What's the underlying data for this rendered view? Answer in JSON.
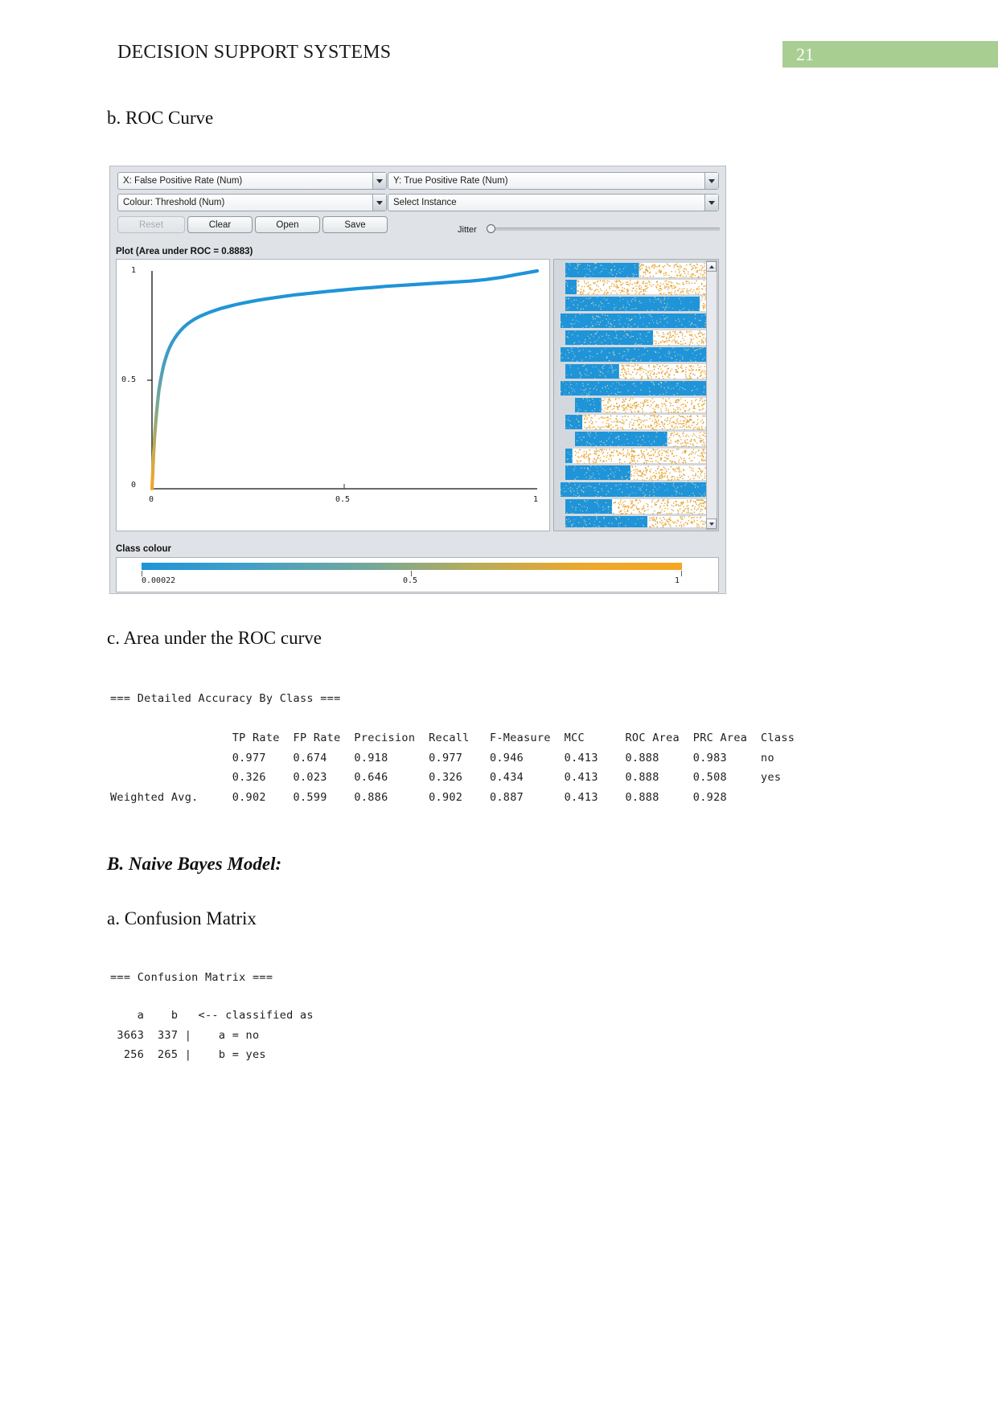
{
  "header": {
    "title": "DECISION SUPPORT SYSTEMS",
    "page_number": "21",
    "badge_color": "#a9ce92"
  },
  "sections": {
    "roc_curve_heading": "b. ROC Curve",
    "auc_heading": "c. Area under the ROC curve",
    "model_heading": "B. Naive Bayes Model:",
    "confusion_heading": "a. Confusion Matrix"
  },
  "weka": {
    "x_axis_combo": "X: False Positive Rate (Num)",
    "y_axis_combo": "Y: True Positive Rate (Num)",
    "colour_combo": "Colour: Threshold (Num)",
    "select_instance": "Select Instance",
    "buttons": {
      "reset": "Reset",
      "clear": "Clear",
      "open": "Open",
      "save": "Save"
    },
    "reset_enabled": false,
    "jitter_label": "Jitter",
    "plot_label": "Plot (Area under ROC = 0.8883)",
    "x_marker": "X",
    "y_marker": "Y",
    "class_colour_label": "Class colour",
    "class_colour_ticks": [
      "0.00022",
      "0.5",
      "1"
    ],
    "colour_start": "#1f94d8",
    "colour_end": "#f5a623"
  },
  "chart_data": {
    "type": "line",
    "title": "Plot (Area under ROC = 0.8883)",
    "xlabel": "False Positive Rate",
    "ylabel": "True Positive Rate",
    "xlim": [
      0,
      1
    ],
    "ylim": [
      0,
      1
    ],
    "xticks": [
      "0",
      "0.5",
      "1"
    ],
    "yticks": [
      "0",
      "0.5",
      "1"
    ],
    "grid": false,
    "legend": null,
    "auc": 0.8883,
    "series": [
      {
        "name": "ROC",
        "x": [
          0.0,
          0.002,
          0.004,
          0.006,
          0.009,
          0.012,
          0.015,
          0.018,
          0.022,
          0.026,
          0.03,
          0.035,
          0.04,
          0.046,
          0.052,
          0.059,
          0.066,
          0.074,
          0.082,
          0.091,
          0.101,
          0.112,
          0.124,
          0.137,
          0.151,
          0.166,
          0.182,
          0.199,
          0.217,
          0.236,
          0.256,
          0.277,
          0.299,
          0.322,
          0.346,
          0.371,
          0.397,
          0.424,
          0.452,
          0.481,
          0.511,
          0.542,
          0.574,
          0.607,
          0.641,
          0.676,
          0.712,
          0.749,
          0.787,
          0.826,
          0.866,
          0.907,
          0.949,
          1.0
        ],
        "y": [
          0.0,
          0.075,
          0.15,
          0.22,
          0.29,
          0.35,
          0.405,
          0.452,
          0.495,
          0.533,
          0.566,
          0.597,
          0.624,
          0.649,
          0.671,
          0.691,
          0.709,
          0.726,
          0.741,
          0.755,
          0.768,
          0.78,
          0.791,
          0.801,
          0.811,
          0.82,
          0.829,
          0.837,
          0.845,
          0.852,
          0.859,
          0.866,
          0.872,
          0.878,
          0.884,
          0.89,
          0.895,
          0.9,
          0.905,
          0.91,
          0.915,
          0.92,
          0.924,
          0.929,
          0.933,
          0.937,
          0.941,
          0.945,
          0.949,
          0.953,
          0.96,
          0.97,
          0.984,
          1.0
        ]
      }
    ]
  },
  "accuracy_report": {
    "title": "=== Detailed Accuracy By Class ===",
    "columns": [
      "",
      "TP Rate",
      "FP Rate",
      "Precision",
      "Recall",
      "F-Measure",
      "MCC",
      "ROC Area",
      "PRC Area",
      "Class"
    ],
    "rows": [
      [
        "",
        "0.977",
        "0.674",
        "0.918",
        "0.977",
        "0.946",
        "0.413",
        "0.888",
        "0.983",
        "no"
      ],
      [
        "",
        "0.326",
        "0.023",
        "0.646",
        "0.326",
        "0.434",
        "0.413",
        "0.888",
        "0.508",
        "yes"
      ],
      [
        "Weighted Avg.",
        "0.902",
        "0.599",
        "0.886",
        "0.902",
        "0.887",
        "0.413",
        "0.888",
        "0.928",
        ""
      ]
    ],
    "text": "                  TP Rate  FP Rate  Precision  Recall   F-Measure  MCC      ROC Area  PRC Area  Class\n                  0.977    0.674    0.918      0.977    0.946      0.413    0.888     0.983     no\n                  0.326    0.023    0.646      0.326    0.434      0.413    0.888     0.508     yes\nWeighted Avg.     0.902    0.599    0.886      0.902    0.887      0.413    0.888     0.928"
  },
  "confusion_report": {
    "title": "=== Confusion Matrix ===",
    "header": "    a    b   <-- classified as",
    "rows": [
      " 3663  337 |    a = no",
      "  256  265 |    b = yes"
    ],
    "text": "    a    b   <-- classified as\n 3663  337 |    a = no\n  256  265 |    b = yes"
  }
}
